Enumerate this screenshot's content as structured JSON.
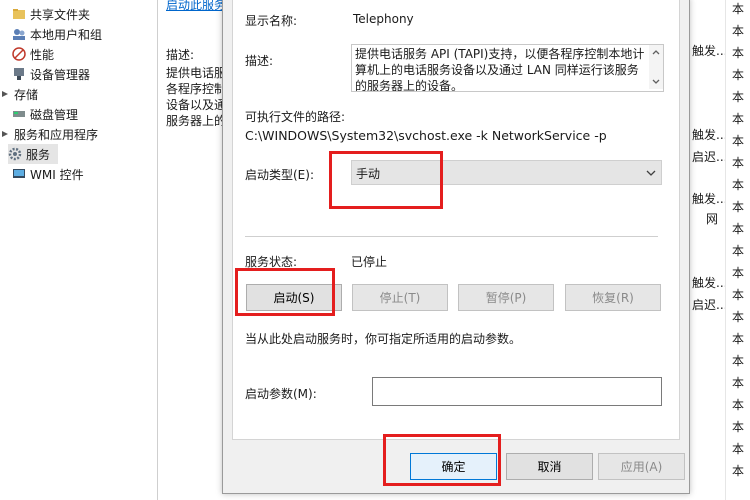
{
  "tree": {
    "items": [
      {
        "label": "共享文件夹",
        "icon": "shared-folder-icon"
      },
      {
        "label": "本地用户和组",
        "icon": "users-group-icon"
      },
      {
        "label": "性能",
        "icon": "performance-icon"
      },
      {
        "label": "设备管理器",
        "icon": "device-manager-icon"
      },
      {
        "label": "存储",
        "icon": "storage-icon"
      },
      {
        "label": "磁盘管理",
        "icon": "disk-icon"
      },
      {
        "label": "服务和应用程序",
        "icon": "services-apps-icon"
      },
      {
        "label": "服务",
        "icon": "services-icon"
      },
      {
        "label": "WMI 控件",
        "icon": "wmi-icon"
      }
    ]
  },
  "background": {
    "link_fragment": "启动此服务",
    "desc_label": "描述:",
    "desc_lines": [
      "提供电话服",
      "各程序控制",
      "设备以及通",
      "服务器上的"
    ],
    "right_col": [
      "触发...",
      "触发...",
      "启迟...",
      "触发...",
      "网",
      "触发...",
      "启迟..."
    ],
    "right_col2": [
      "本",
      "本",
      "本",
      "本",
      "本",
      "本",
      "本",
      "本",
      "本",
      "本",
      "本",
      "本",
      "本",
      "本",
      "本",
      "本",
      "本",
      "本",
      "本",
      "本",
      "本",
      "本"
    ]
  },
  "dialog": {
    "display_name_label": "显示名称:",
    "display_name_value": "Telephony",
    "description_label": "描述:",
    "description_text": "提供电话服务 API (TAPI)支持，以便各程序控制本地计算机上的电话服务设备以及通过 LAN 同样运行该服务的服务器上的设备。",
    "exe_path_label": "可执行文件的路径:",
    "exe_path_value": "C:\\WINDOWS\\System32\\svchost.exe -k NetworkService -p",
    "startup_type_label": "启动类型(E):",
    "startup_type_value": "手动",
    "service_status_label": "服务状态:",
    "service_status_value": "已停止",
    "start_button": "启动(S)",
    "stop_button": "停止(T)",
    "pause_button": "暂停(P)",
    "resume_button": "恢复(R)",
    "hint_text": "当从此处启动服务时，你可指定所适用的启动参数。",
    "start_params_label": "启动参数(M):",
    "start_params_value": "",
    "ok_button": "确定",
    "cancel_button": "取消",
    "apply_button": "应用(A)"
  },
  "colors": {
    "highlight_box": "#e41e1e",
    "dialog_bg": "#f0f0f0",
    "button_bg": "#e1e1e1",
    "primary_border": "#0078d7"
  }
}
